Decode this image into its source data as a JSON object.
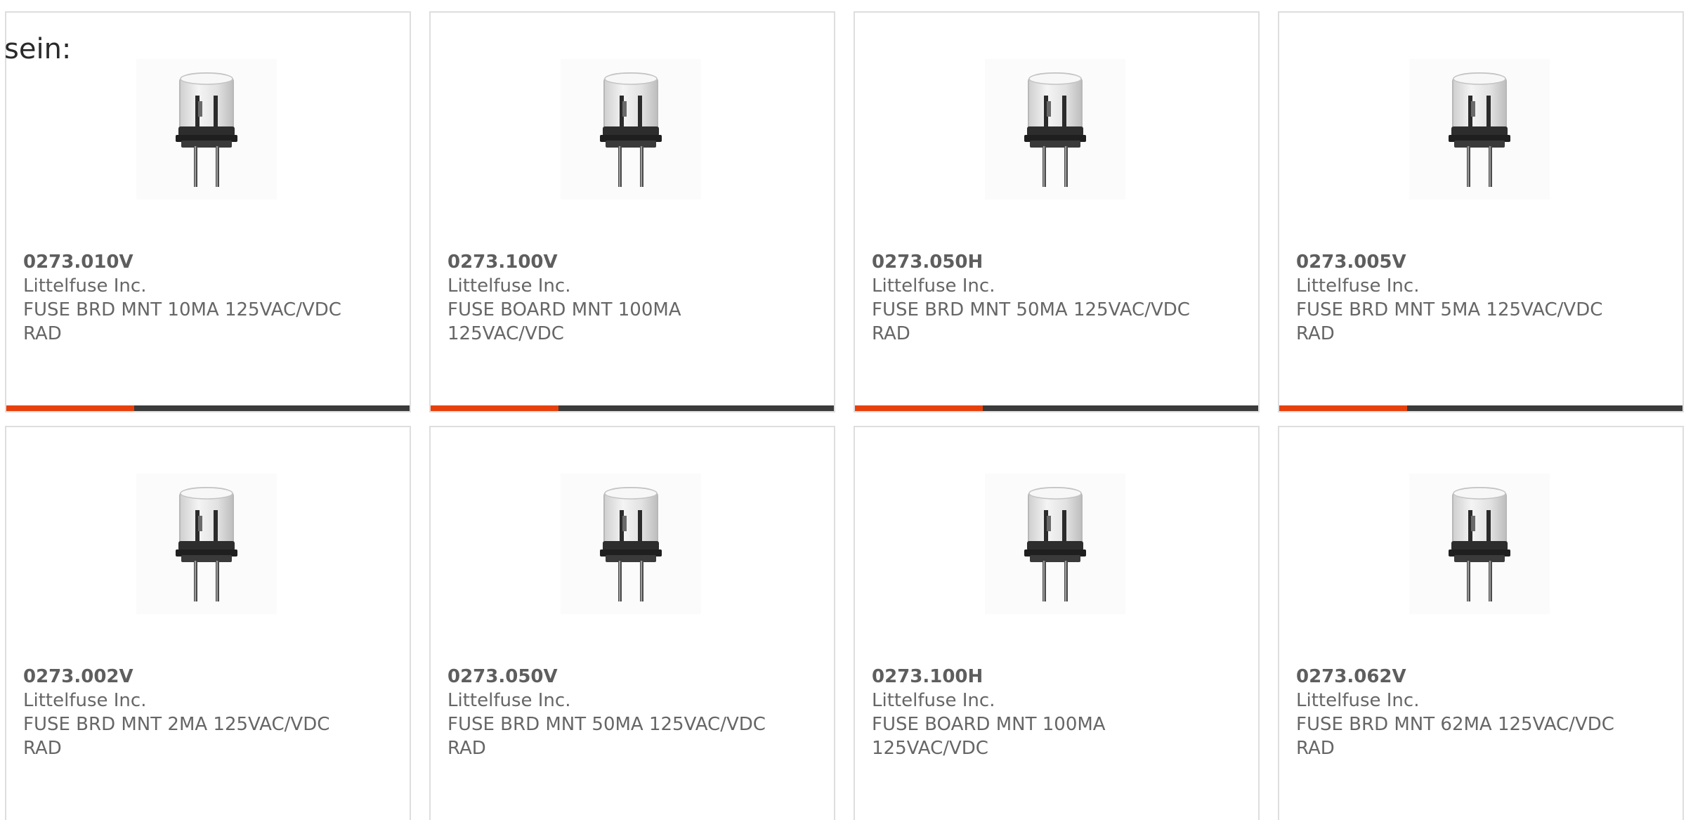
{
  "page": {
    "lead_text": "sein:"
  },
  "theme": {
    "accent": "#e8400c",
    "bar": "#3b3b3b",
    "border": "#dedede",
    "text": "#666666"
  },
  "products": [
    {
      "part_number": "0273.010V",
      "manufacturer": "Littelfuse Inc.",
      "description": "FUSE BRD MNT 10MA 125VAC/VDC RAD",
      "image_icon": "fuse-icon"
    },
    {
      "part_number": "0273.100V",
      "manufacturer": "Littelfuse Inc.",
      "description": "FUSE BOARD MNT 100MA 125VAC/VDC",
      "image_icon": "fuse-icon"
    },
    {
      "part_number": "0273.050H",
      "manufacturer": "Littelfuse Inc.",
      "description": "FUSE BRD MNT 50MA 125VAC/VDC RAD",
      "image_icon": "fuse-icon"
    },
    {
      "part_number": "0273.005V",
      "manufacturer": "Littelfuse Inc.",
      "description": "FUSE BRD MNT 5MA 125VAC/VDC RAD",
      "image_icon": "fuse-icon"
    },
    {
      "part_number": "0273.002V",
      "manufacturer": "Littelfuse Inc.",
      "description": "FUSE BRD MNT 2MA 125VAC/VDC RAD",
      "image_icon": "fuse-icon"
    },
    {
      "part_number": "0273.050V",
      "manufacturer": "Littelfuse Inc.",
      "description": "FUSE BRD MNT 50MA 125VAC/VDC RAD",
      "image_icon": "fuse-icon"
    },
    {
      "part_number": "0273.100H",
      "manufacturer": "Littelfuse Inc.",
      "description": "FUSE BOARD MNT 100MA 125VAC/VDC",
      "image_icon": "fuse-icon"
    },
    {
      "part_number": "0273.062V",
      "manufacturer": "Littelfuse Inc.",
      "description": "FUSE BRD MNT 62MA 125VAC/VDC RAD",
      "image_icon": "fuse-icon"
    }
  ]
}
